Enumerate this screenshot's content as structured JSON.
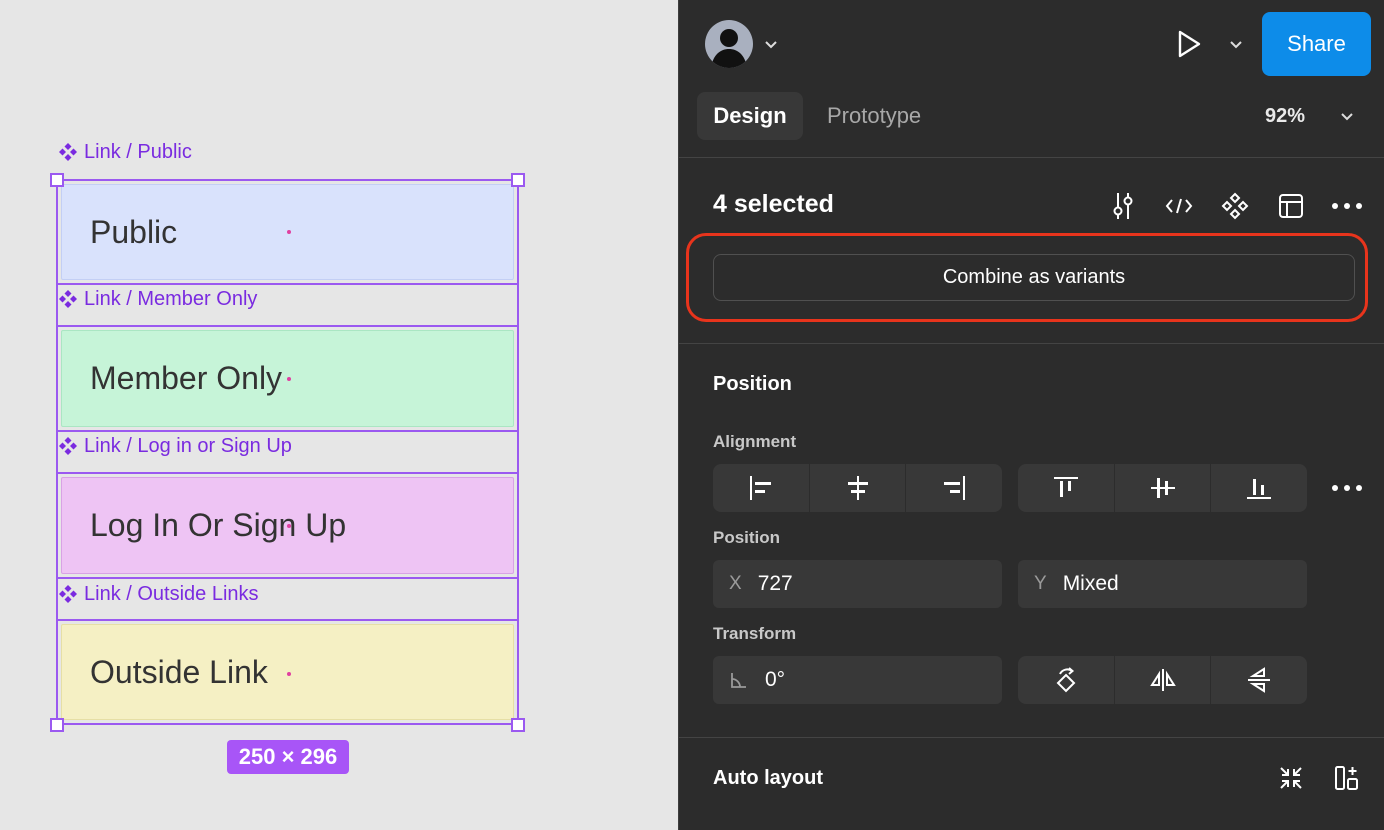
{
  "canvas": {
    "components": [
      {
        "label": "Link / Public",
        "text": "Public"
      },
      {
        "label": "Link / Member Only",
        "text": "Member Only"
      },
      {
        "label": "Link / Log in or Sign Up",
        "text": "Log In Or Sign Up"
      },
      {
        "label": "Link / Outside Links",
        "text": "Outside Link"
      }
    ],
    "size_badge": "250 × 296"
  },
  "header": {
    "share_label": "Share",
    "tabs": {
      "design": "Design",
      "prototype": "Prototype"
    },
    "zoom": "92%"
  },
  "selection": {
    "count_label": "4 selected",
    "combine_button": "Combine as variants"
  },
  "position": {
    "title": "Position",
    "alignment_label": "Alignment",
    "position_label": "Position",
    "x_prefix": "X",
    "x_value": "727",
    "y_prefix": "Y",
    "y_value": "Mixed",
    "transform_label": "Transform",
    "rotation_value": "0°"
  },
  "auto_layout": {
    "title": "Auto layout"
  },
  "colors": {
    "accent": "#0d8ce9",
    "selection": "#9b59f0",
    "component_label": "#7a2be0",
    "highlight": "#e8341c"
  }
}
